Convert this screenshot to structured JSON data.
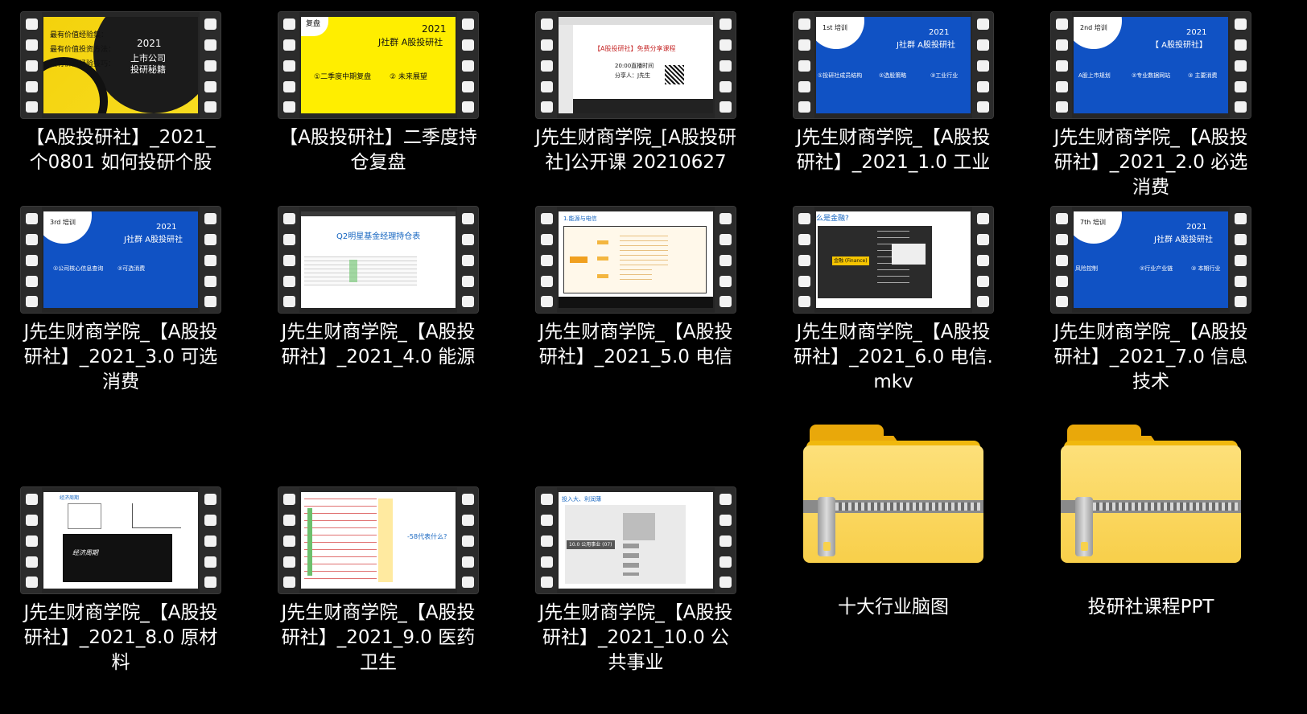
{
  "items": [
    {
      "label": "【A股投研社】_2021_个0801 如何投研个股",
      "type": "video"
    },
    {
      "label": "【A股投研社】二季度持仓复盘",
      "type": "video"
    },
    {
      "label": "J先生财商学院_[A股投研社]公开课 20210627",
      "type": "video"
    },
    {
      "label": "J先生财商学院_【A股投研社】_2021_1.0 工业",
      "type": "video"
    },
    {
      "label": "J先生财商学院_【A股投研社】_2021_2.0 必选消费",
      "type": "video"
    },
    {
      "label": "J先生财商学院_【A股投研社】_2021_3.0 可选消费",
      "type": "video"
    },
    {
      "label": "J先生财商学院_【A股投研社】_2021_4.0 能源",
      "type": "video"
    },
    {
      "label": "J先生财商学院_【A股投研社】_2021_5.0 电信",
      "type": "video"
    },
    {
      "label": "J先生财商学院_【A股投研社】_2021_6.0 电信.mkv",
      "type": "video"
    },
    {
      "label": "J先生财商学院_【A股投研社】_2021_7.0 信息技术",
      "type": "video"
    },
    {
      "label": "J先生财商学院_【A股投研社】_2021_8.0 原材料",
      "type": "video"
    },
    {
      "label": "J先生财商学院_【A股投研社】_2021_9.0 医药卫生",
      "type": "video"
    },
    {
      "label": "J先生财商学院_【A股投研社】_2021_10.0 公共事业",
      "type": "video"
    },
    {
      "label": "十大行业脑图",
      "type": "zip-folder"
    },
    {
      "label": "投研社课程PPT",
      "type": "zip-folder"
    }
  ],
  "thumbs": {
    "t0": {
      "a": "最有价值经验集：",
      "b": "最有价值投资方法：",
      "c": "最有价值经验技巧：",
      "year": "2021",
      "t1": "上市公司",
      "t2": "投研秘籍"
    },
    "t1": {
      "tag": "复盘",
      "year": "2021",
      "title": "J社群 A股投研社",
      "s1": "①二季度中期复盘",
      "s2": "② 未来展望"
    },
    "t2": {
      "title": "【A股投研社】免费分享课程",
      "sub": "20:00直播时间",
      "host": "分享人：J先生"
    },
    "t3": {
      "tag": "1st 培训",
      "year": "2021",
      "title": "J社群 A股投研社",
      "s1": "①投研社成员结构",
      "s2": "②选股策略",
      "s3": "③工业行业"
    },
    "t4": {
      "tag": "2nd 培训",
      "year": "2021",
      "title": "【 A股投研社】",
      "s1": "A股上市规划",
      "s2": "②专业数据网站",
      "s3": "③ 主要消费"
    },
    "t5": {
      "tag": "3rd 培训",
      "year": "2021",
      "title": "J社群 A股投研社",
      "s1": "①公司核心信息查询",
      "s2": "②可选消费"
    },
    "t6": {
      "title": "Q2明星基金经理持仓表"
    },
    "t7": {
      "title": "1.能源与电信"
    },
    "t8": {
      "title": "么是金融?",
      "node": "金融 (Finance)"
    },
    "t9": {
      "tag": "7th 培训",
      "year": "2021",
      "title": "J社群 A股投研社",
      "s1": "风险控制",
      "s2": "②行业产业链",
      "s3": "③ 本期行业"
    },
    "t10": {
      "a": "经济周期",
      "b": "经济周期"
    },
    "t11": {
      "q": "-58代表什么?"
    },
    "t12": {
      "title": "投入大、利润薄",
      "node": "10.0 公用事业 (07)"
    }
  }
}
